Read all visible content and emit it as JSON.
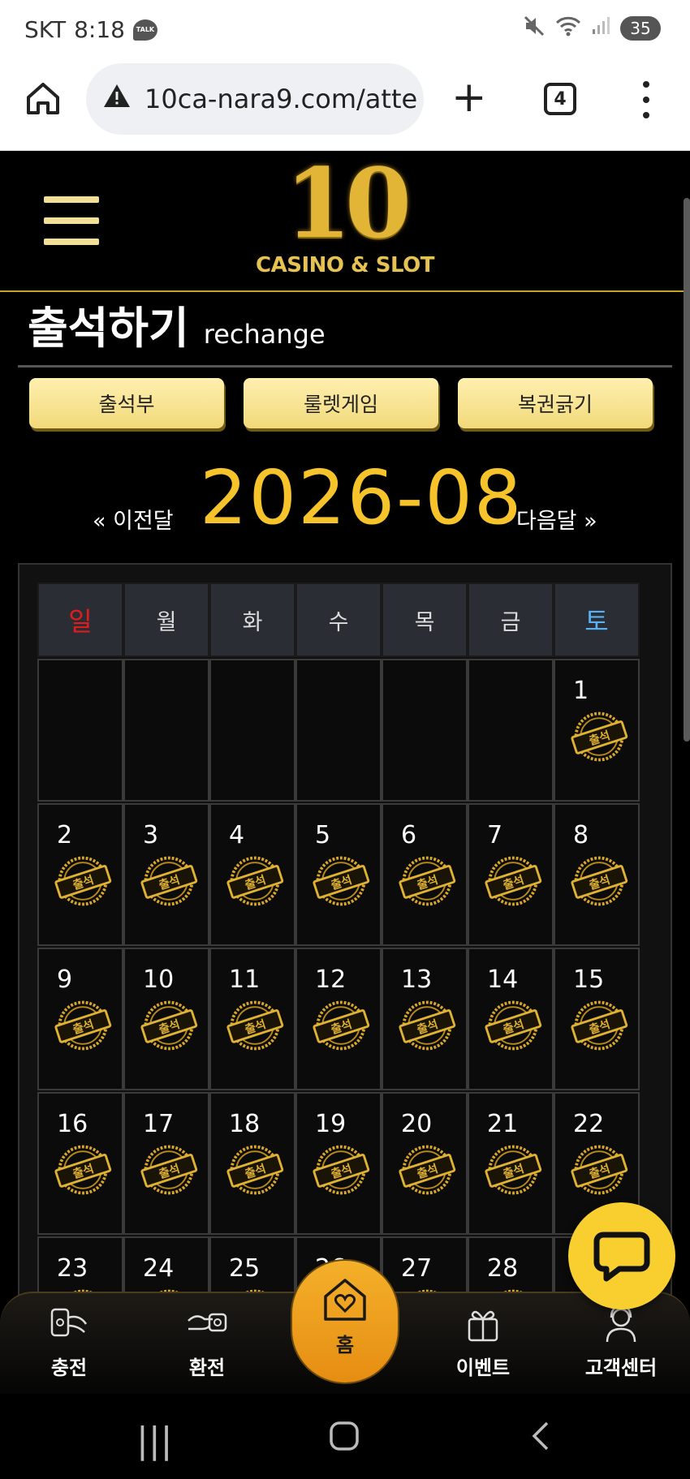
{
  "status_bar": {
    "carrier": "SKT",
    "time": "8:18",
    "talk_badge": "TALK",
    "battery": "35"
  },
  "browser": {
    "url": "10ca-nara9.com/atte",
    "tab_count": "4"
  },
  "site": {
    "logo_number": "10",
    "logo_text": "CASINO & SLOT"
  },
  "page": {
    "title": "출석하기",
    "subtitle": "rechange"
  },
  "tabs": [
    {
      "label": "출석부"
    },
    {
      "label": "룰렛게임"
    },
    {
      "label": "복권긁기"
    }
  ],
  "month_nav": {
    "prev": "« 이전달",
    "current": "2026-08",
    "next": "다음달 »"
  },
  "calendar": {
    "weekdays": [
      "일",
      "월",
      "화",
      "수",
      "목",
      "금",
      "토"
    ],
    "stamp_text": "출석",
    "weeks": [
      [
        "",
        "",
        "",
        "",
        "",
        "",
        "1"
      ],
      [
        "2",
        "3",
        "4",
        "5",
        "6",
        "7",
        "8"
      ],
      [
        "9",
        "10",
        "11",
        "12",
        "13",
        "14",
        "15"
      ],
      [
        "16",
        "17",
        "18",
        "19",
        "20",
        "21",
        "22"
      ],
      [
        "23",
        "24",
        "25",
        "26",
        "27",
        "28",
        ""
      ]
    ]
  },
  "bottom_nav": [
    {
      "label": "충전",
      "icon": "charge-icon"
    },
    {
      "label": "환전",
      "icon": "exchange-icon"
    },
    {
      "label": "홈",
      "icon": "home-heart-icon"
    },
    {
      "label": "이벤트",
      "icon": "gift-icon"
    },
    {
      "label": "고객센터",
      "icon": "support-agent-icon"
    }
  ],
  "colors": {
    "gold": "#f6c32b",
    "sunday": "#e21c1c",
    "saturday": "#58b2f3",
    "tab_bg": "#f1d97a"
  }
}
